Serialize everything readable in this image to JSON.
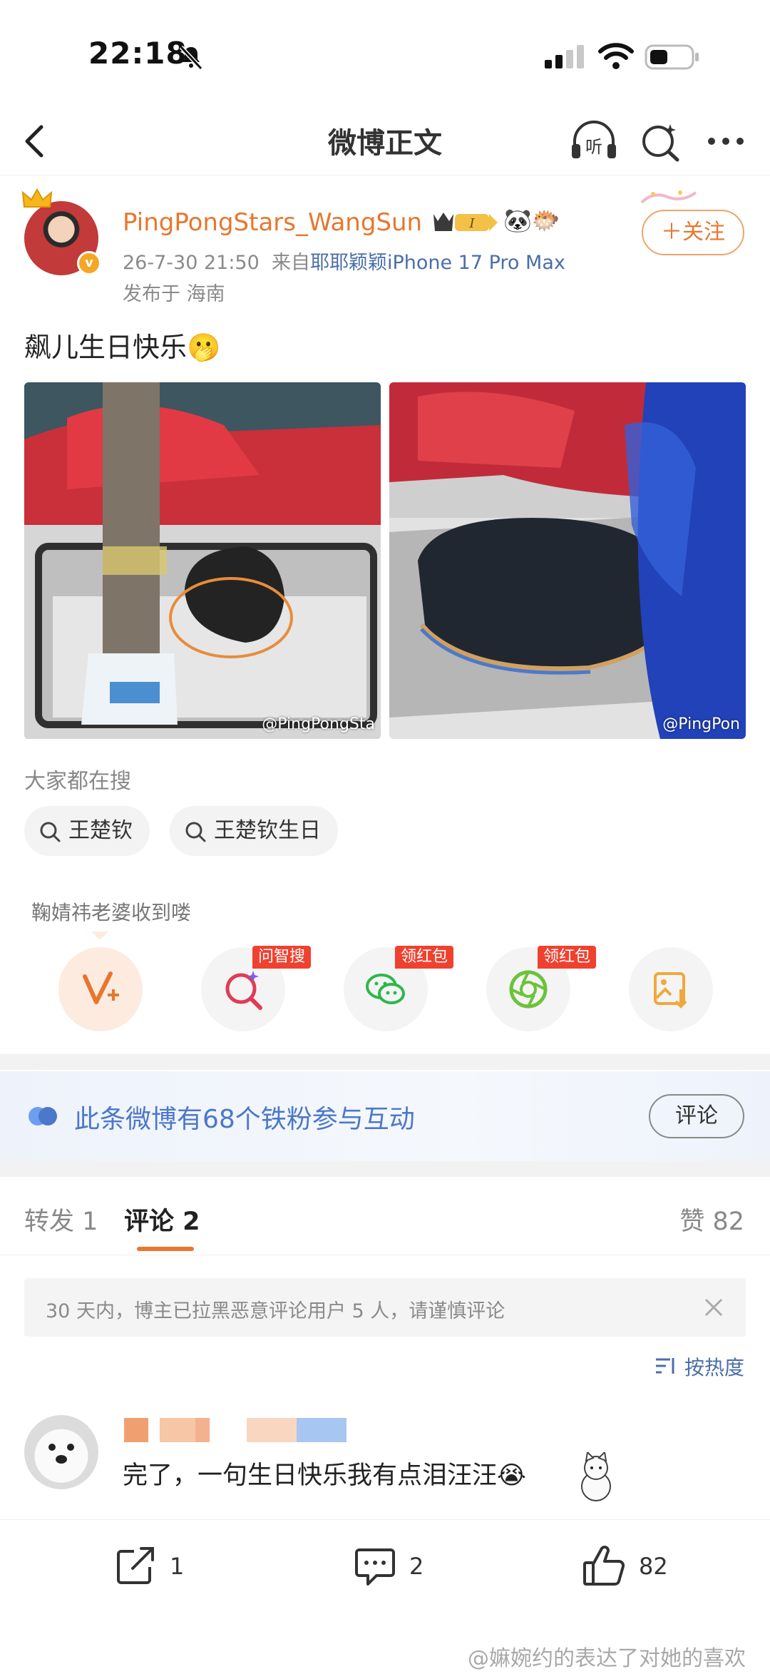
{
  "status_bar": {
    "time": "22:18"
  },
  "nav": {
    "title": "微博正文"
  },
  "post": {
    "username": "PingPongStars_WangSun",
    "date": "26-7-30 21:50",
    "source_prefix": "来自",
    "source": "耶耶颖颖iPhone 17 Pro Max",
    "location": "发布于 海南",
    "follow_label": "＋关注",
    "text": "飙儿生日快乐🫢",
    "images": [
      {
        "watermark": "@PingPongSta"
      },
      {
        "watermark": "@PingPon"
      }
    ]
  },
  "trending": {
    "label": "大家都在搜",
    "chips": [
      "王楚钦",
      "王楚钦生日"
    ]
  },
  "reward_text": "鞠婧祎老婆收到喽",
  "actions": [
    {
      "icon": "vplus-icon"
    },
    {
      "icon": "smart-search-icon",
      "tag": "问智搜"
    },
    {
      "icon": "wechat-icon",
      "tag": "领红包"
    },
    {
      "icon": "moments-icon",
      "tag": "领红包"
    },
    {
      "icon": "save-image-icon"
    }
  ],
  "fans_banner": {
    "text": "此条微博有68个铁粉参与互动",
    "button": "评论"
  },
  "tabs": {
    "repost": "转发 1",
    "comments": "评论 2",
    "likes": "赞 82"
  },
  "notice": {
    "text": "30 天内，博主已拉黑恶意评论用户 5 人，请谨慎评论"
  },
  "sort": {
    "label": "按热度"
  },
  "comment": {
    "text": "完了，一句生日快乐我有点泪汪汪😭"
  },
  "bottom_bar": {
    "repost_count": "1",
    "comment_count": "2",
    "like_count": "82"
  },
  "footer_watermark": "@嫲婉约的表达了对她的喜欢",
  "colors": {
    "accent": "#e8762e",
    "link": "#4c6da8",
    "tag_red": "#f0412f"
  }
}
